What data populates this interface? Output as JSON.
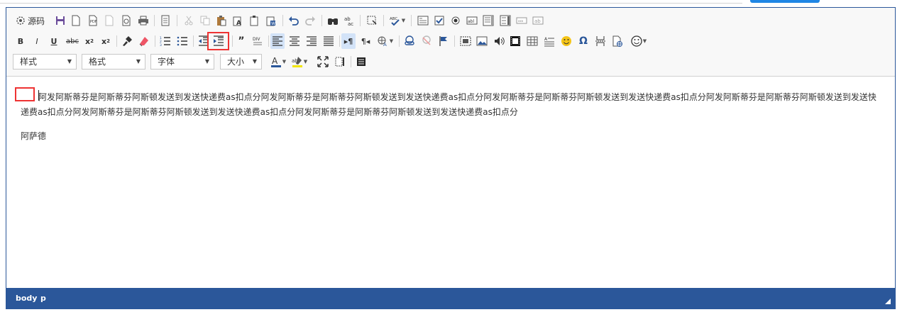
{
  "source_button_label": "源码",
  "combos": {
    "style": "样式",
    "format": "格式",
    "font": "字体",
    "size": "大小"
  },
  "toolbar_icons": {
    "row1": [
      "source-icon",
      "save-icon",
      "new-page-icon",
      "pdf-icon",
      "preview-icon",
      "print-preview-icon",
      "print-icon",
      "templates-icon",
      "cut-icon",
      "copy-icon",
      "paste-icon",
      "paste-text-icon",
      "paste-word-icon",
      "paste-word2-icon",
      "undo-icon",
      "redo-icon",
      "find-icon",
      "replace-icon",
      "select-all-icon",
      "spellcheck-icon",
      "form-icon",
      "checkbox-icon",
      "radio-icon",
      "textfield-icon",
      "textarea-icon",
      "select-icon",
      "button-icon",
      "imagebutton-icon"
    ],
    "row2": [
      "bold-icon",
      "italic-icon",
      "underline-icon",
      "strike-icon",
      "subscript-icon",
      "superscript-icon",
      "format-painter-icon",
      "remove-format-icon",
      "numbered-list-icon",
      "bulleted-list-icon",
      "outdent-icon",
      "indent-icon",
      "blockquote-icon",
      "div-icon",
      "align-left-icon",
      "align-center-icon",
      "align-right-icon",
      "justify-icon",
      "ltr-icon",
      "rtl-icon",
      "language-icon",
      "link-icon",
      "unlink-icon",
      "anchor-icon",
      "iframe-icon",
      "image-icon",
      "audio-icon",
      "video-icon",
      "table-icon",
      "horizontal-rule-icon",
      "smiley-icon",
      "special-char-icon",
      "page-break-icon",
      "file-icon",
      "emoji-icon"
    ]
  },
  "content": {
    "paragraph1": "阿发阿斯蒂芬是阿斯蒂芬阿斯顿发送到发送快递费as扣点分阿发阿斯蒂芬是阿斯蒂芬阿斯顿发送到发送快递费as扣点分阿发阿斯蒂芬是阿斯蒂芬阿斯顿发送到发送快递费as扣点分阿发阿斯蒂芬是阿斯蒂芬阿斯顿发送到发送快递费as扣点分阿发阿斯蒂芬是阿斯蒂芬阿斯顿发送到发送快递费as扣点分阿发阿斯蒂芬是阿斯蒂芬阿斯顿发送到发送快递费as扣点分",
    "paragraph2": "阿萨德"
  },
  "status_path": [
    "body",
    "p"
  ],
  "colors": {
    "border": "#2b579a",
    "statusbar": "#2b579a",
    "highlight": "#e33333",
    "active_button": "#d3e3f8",
    "primary_button": "#1f86e5"
  }
}
